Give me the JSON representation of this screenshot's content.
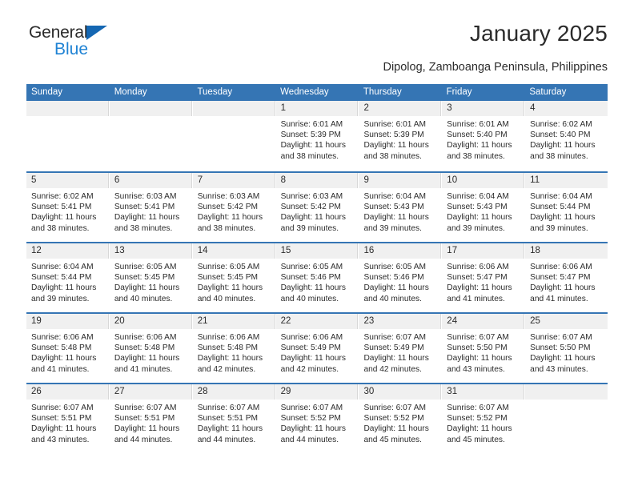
{
  "brand": {
    "name_part1": "General",
    "name_part2": "Blue",
    "logo_icon": "triangle-icon"
  },
  "header": {
    "title": "January 2025",
    "subtitle": "Dipolog, Zamboanga Peninsula, Philippines"
  },
  "colors": {
    "header_blue": "#3575b4",
    "brand_blue": "#2083d4",
    "logo_triangle": "#1567b3",
    "day_band": "#f0f0f0",
    "text": "#2b2b2b"
  },
  "weekdays": [
    "Sunday",
    "Monday",
    "Tuesday",
    "Wednesday",
    "Thursday",
    "Friday",
    "Saturday"
  ],
  "weeks": [
    [
      {
        "empty": true
      },
      {
        "empty": true
      },
      {
        "empty": true
      },
      {
        "day": "1",
        "sunrise": "Sunrise: 6:01 AM",
        "sunset": "Sunset: 5:39 PM",
        "daylight_line1": "Daylight: 11 hours",
        "daylight_line2": "and 38 minutes."
      },
      {
        "day": "2",
        "sunrise": "Sunrise: 6:01 AM",
        "sunset": "Sunset: 5:39 PM",
        "daylight_line1": "Daylight: 11 hours",
        "daylight_line2": "and 38 minutes."
      },
      {
        "day": "3",
        "sunrise": "Sunrise: 6:01 AM",
        "sunset": "Sunset: 5:40 PM",
        "daylight_line1": "Daylight: 11 hours",
        "daylight_line2": "and 38 minutes."
      },
      {
        "day": "4",
        "sunrise": "Sunrise: 6:02 AM",
        "sunset": "Sunset: 5:40 PM",
        "daylight_line1": "Daylight: 11 hours",
        "daylight_line2": "and 38 minutes."
      }
    ],
    [
      {
        "day": "5",
        "sunrise": "Sunrise: 6:02 AM",
        "sunset": "Sunset: 5:41 PM",
        "daylight_line1": "Daylight: 11 hours",
        "daylight_line2": "and 38 minutes."
      },
      {
        "day": "6",
        "sunrise": "Sunrise: 6:03 AM",
        "sunset": "Sunset: 5:41 PM",
        "daylight_line1": "Daylight: 11 hours",
        "daylight_line2": "and 38 minutes."
      },
      {
        "day": "7",
        "sunrise": "Sunrise: 6:03 AM",
        "sunset": "Sunset: 5:42 PM",
        "daylight_line1": "Daylight: 11 hours",
        "daylight_line2": "and 38 minutes."
      },
      {
        "day": "8",
        "sunrise": "Sunrise: 6:03 AM",
        "sunset": "Sunset: 5:42 PM",
        "daylight_line1": "Daylight: 11 hours",
        "daylight_line2": "and 39 minutes."
      },
      {
        "day": "9",
        "sunrise": "Sunrise: 6:04 AM",
        "sunset": "Sunset: 5:43 PM",
        "daylight_line1": "Daylight: 11 hours",
        "daylight_line2": "and 39 minutes."
      },
      {
        "day": "10",
        "sunrise": "Sunrise: 6:04 AM",
        "sunset": "Sunset: 5:43 PM",
        "daylight_line1": "Daylight: 11 hours",
        "daylight_line2": "and 39 minutes."
      },
      {
        "day": "11",
        "sunrise": "Sunrise: 6:04 AM",
        "sunset": "Sunset: 5:44 PM",
        "daylight_line1": "Daylight: 11 hours",
        "daylight_line2": "and 39 minutes."
      }
    ],
    [
      {
        "day": "12",
        "sunrise": "Sunrise: 6:04 AM",
        "sunset": "Sunset: 5:44 PM",
        "daylight_line1": "Daylight: 11 hours",
        "daylight_line2": "and 39 minutes."
      },
      {
        "day": "13",
        "sunrise": "Sunrise: 6:05 AM",
        "sunset": "Sunset: 5:45 PM",
        "daylight_line1": "Daylight: 11 hours",
        "daylight_line2": "and 40 minutes."
      },
      {
        "day": "14",
        "sunrise": "Sunrise: 6:05 AM",
        "sunset": "Sunset: 5:45 PM",
        "daylight_line1": "Daylight: 11 hours",
        "daylight_line2": "and 40 minutes."
      },
      {
        "day": "15",
        "sunrise": "Sunrise: 6:05 AM",
        "sunset": "Sunset: 5:46 PM",
        "daylight_line1": "Daylight: 11 hours",
        "daylight_line2": "and 40 minutes."
      },
      {
        "day": "16",
        "sunrise": "Sunrise: 6:05 AM",
        "sunset": "Sunset: 5:46 PM",
        "daylight_line1": "Daylight: 11 hours",
        "daylight_line2": "and 40 minutes."
      },
      {
        "day": "17",
        "sunrise": "Sunrise: 6:06 AM",
        "sunset": "Sunset: 5:47 PM",
        "daylight_line1": "Daylight: 11 hours",
        "daylight_line2": "and 41 minutes."
      },
      {
        "day": "18",
        "sunrise": "Sunrise: 6:06 AM",
        "sunset": "Sunset: 5:47 PM",
        "daylight_line1": "Daylight: 11 hours",
        "daylight_line2": "and 41 minutes."
      }
    ],
    [
      {
        "day": "19",
        "sunrise": "Sunrise: 6:06 AM",
        "sunset": "Sunset: 5:48 PM",
        "daylight_line1": "Daylight: 11 hours",
        "daylight_line2": "and 41 minutes."
      },
      {
        "day": "20",
        "sunrise": "Sunrise: 6:06 AM",
        "sunset": "Sunset: 5:48 PM",
        "daylight_line1": "Daylight: 11 hours",
        "daylight_line2": "and 41 minutes."
      },
      {
        "day": "21",
        "sunrise": "Sunrise: 6:06 AM",
        "sunset": "Sunset: 5:48 PM",
        "daylight_line1": "Daylight: 11 hours",
        "daylight_line2": "and 42 minutes."
      },
      {
        "day": "22",
        "sunrise": "Sunrise: 6:06 AM",
        "sunset": "Sunset: 5:49 PM",
        "daylight_line1": "Daylight: 11 hours",
        "daylight_line2": "and 42 minutes."
      },
      {
        "day": "23",
        "sunrise": "Sunrise: 6:07 AM",
        "sunset": "Sunset: 5:49 PM",
        "daylight_line1": "Daylight: 11 hours",
        "daylight_line2": "and 42 minutes."
      },
      {
        "day": "24",
        "sunrise": "Sunrise: 6:07 AM",
        "sunset": "Sunset: 5:50 PM",
        "daylight_line1": "Daylight: 11 hours",
        "daylight_line2": "and 43 minutes."
      },
      {
        "day": "25",
        "sunrise": "Sunrise: 6:07 AM",
        "sunset": "Sunset: 5:50 PM",
        "daylight_line1": "Daylight: 11 hours",
        "daylight_line2": "and 43 minutes."
      }
    ],
    [
      {
        "day": "26",
        "sunrise": "Sunrise: 6:07 AM",
        "sunset": "Sunset: 5:51 PM",
        "daylight_line1": "Daylight: 11 hours",
        "daylight_line2": "and 43 minutes."
      },
      {
        "day": "27",
        "sunrise": "Sunrise: 6:07 AM",
        "sunset": "Sunset: 5:51 PM",
        "daylight_line1": "Daylight: 11 hours",
        "daylight_line2": "and 44 minutes."
      },
      {
        "day": "28",
        "sunrise": "Sunrise: 6:07 AM",
        "sunset": "Sunset: 5:51 PM",
        "daylight_line1": "Daylight: 11 hours",
        "daylight_line2": "and 44 minutes."
      },
      {
        "day": "29",
        "sunrise": "Sunrise: 6:07 AM",
        "sunset": "Sunset: 5:52 PM",
        "daylight_line1": "Daylight: 11 hours",
        "daylight_line2": "and 44 minutes."
      },
      {
        "day": "30",
        "sunrise": "Sunrise: 6:07 AM",
        "sunset": "Sunset: 5:52 PM",
        "daylight_line1": "Daylight: 11 hours",
        "daylight_line2": "and 45 minutes."
      },
      {
        "day": "31",
        "sunrise": "Sunrise: 6:07 AM",
        "sunset": "Sunset: 5:52 PM",
        "daylight_line1": "Daylight: 11 hours",
        "daylight_line2": "and 45 minutes."
      },
      {
        "empty": true
      }
    ]
  ]
}
